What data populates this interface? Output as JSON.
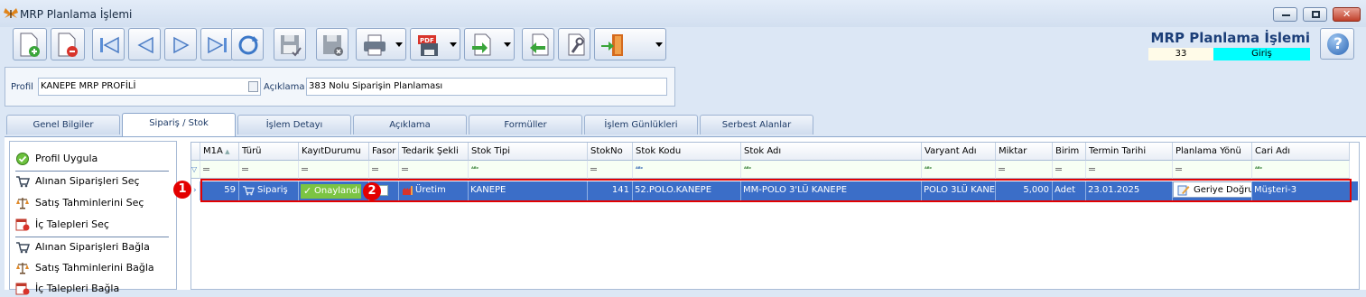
{
  "window": {
    "title": "MRP Planlama İşlemi"
  },
  "header": {
    "title": "MRP Planlama İşlemi",
    "number": "33",
    "state": "Giriş",
    "state_color": "#00ffff"
  },
  "profile": {
    "label": "Profil",
    "value": "KANEPE MRP PROFİLİ",
    "desc_label": "Açıklama",
    "desc_value": "383 Nolu Siparişin Planlaması"
  },
  "tabs": [
    "Genel Bilgiler",
    "Sipariş / Stok",
    "İşlem Detayı",
    "Açıklama",
    "Formüller",
    "İşlem Günlükleri",
    "Serbest Alanlar"
  ],
  "actions": [
    "Profil Uygula",
    "Alınan Siparişleri Seç",
    "Satış Tahminlerini Seç",
    "İç Talepleri Seç",
    "Alınan Siparişleri Bağla",
    "Satış Tahminlerini Bağla",
    "İç Talepleri Bağla"
  ],
  "grid": {
    "columns": [
      "M1A",
      "Türü",
      "KayıtDurumu",
      "Fasor",
      "Tedarik Şekli",
      "Stok Tipi",
      "StokNo",
      "Stok Kodu",
      "Stok Adı",
      "Varyant Adı",
      "Miktar",
      "Birim",
      "Termin Tarihi",
      "Planlama Yönü",
      "Cari Adı"
    ],
    "row": {
      "m1a": "59",
      "turu": "Sipariş",
      "kayit_durumu": "Onaylandı",
      "tedarik": "Üretim",
      "stok_tipi": "KANEPE",
      "stok_no": "141",
      "stok_kodu": "52.POLO.KANEPE",
      "stok_adi": "MM-POLO 3'LÜ KANEPE",
      "varyant": "POLO 3LÜ KANE",
      "miktar": "5,000",
      "birim": "Adet",
      "termin": "23.01.2025",
      "planlama": "Geriye Doğru",
      "cari": "Müşteri-3"
    }
  },
  "markers": [
    "1",
    "2"
  ],
  "colors": {
    "selection": "#3b6ec8",
    "highlight": "#e30000",
    "approved": "#7bc443"
  }
}
